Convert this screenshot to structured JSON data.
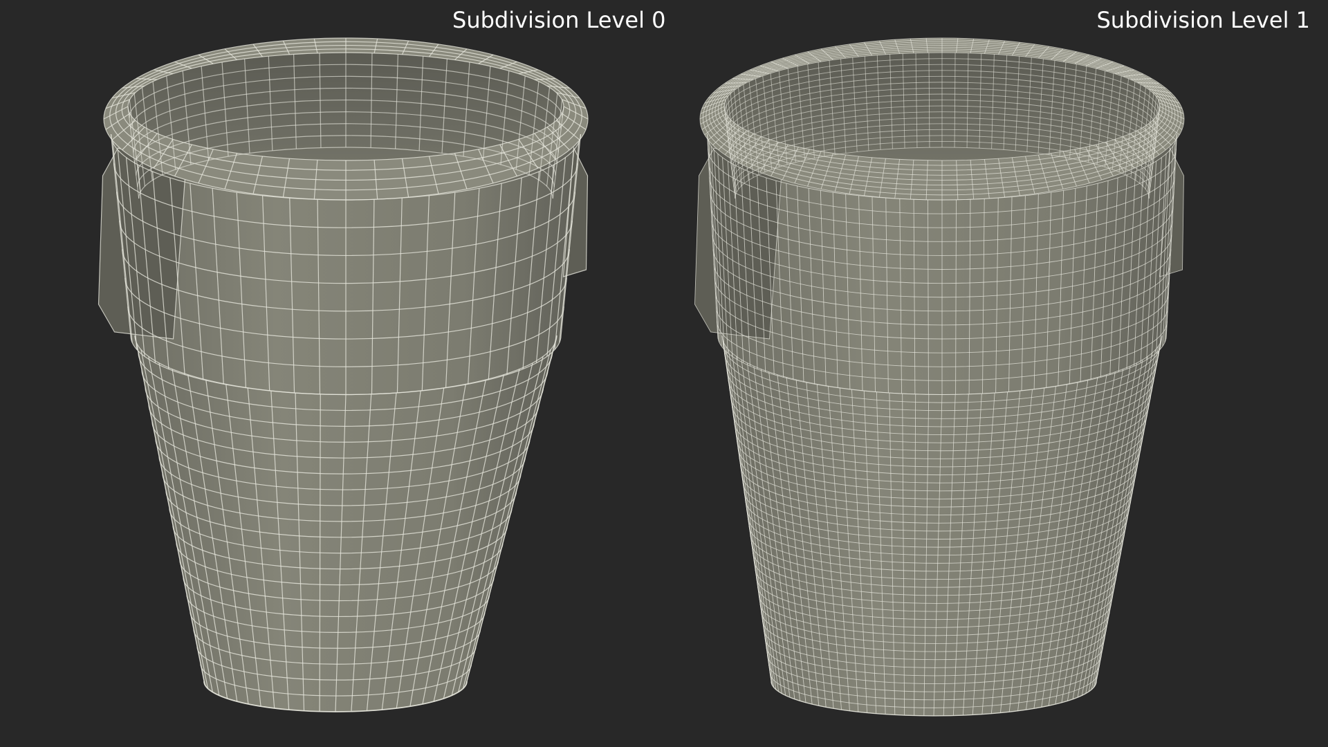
{
  "viewports": [
    {
      "label": "Subdivision Level 0",
      "density": 1
    },
    {
      "label": "Subdivision Level 1",
      "density": 2
    }
  ],
  "colors": {
    "background": "#282828",
    "surface": "#7a7a6e",
    "surface_dark": "#5e5e55",
    "wire": "#e6e6dc",
    "caption": "#ffffff"
  },
  "icons": [
    "trash-can-model-level-0",
    "trash-can-model-level-1"
  ]
}
